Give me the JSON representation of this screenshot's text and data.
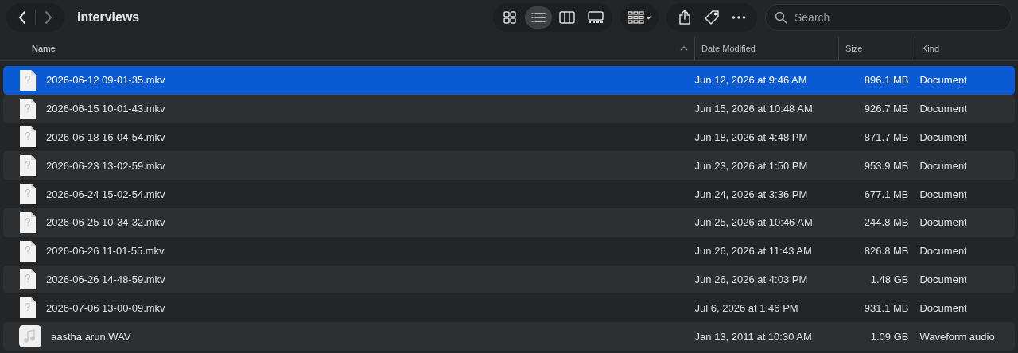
{
  "window": {
    "title": "interviews"
  },
  "views": [
    {
      "kind": "icons",
      "selected": false
    },
    {
      "kind": "list",
      "selected": true
    },
    {
      "kind": "columns",
      "selected": false
    },
    {
      "kind": "gallery",
      "selected": false
    }
  ],
  "search": {
    "placeholder": "Search"
  },
  "columns": [
    {
      "label": "Name",
      "sorted": true
    },
    {
      "label": "Date Modified",
      "sorted": false
    },
    {
      "label": "Size",
      "sorted": false
    },
    {
      "label": "Kind",
      "sorted": false
    }
  ],
  "rows": [
    {
      "kind": "document",
      "name": "2026-06-12 09-01-35.mkv",
      "date": "Jun 12, 2026 at 9:46 AM",
      "size": "896.1 MB",
      "type": "Document",
      "selected": true
    },
    {
      "kind": "document",
      "name": "2026-06-15 10-01-43.mkv",
      "date": "Jun 15, 2026 at 10:48 AM",
      "size": "926.7 MB",
      "type": "Document",
      "selected": false
    },
    {
      "kind": "document",
      "name": "2026-06-18 16-04-54.mkv",
      "date": "Jun 18, 2026 at 4:48 PM",
      "size": "871.7 MB",
      "type": "Document",
      "selected": false
    },
    {
      "kind": "document",
      "name": "2026-06-23 13-02-59.mkv",
      "date": "Jun 23, 2026 at 1:50 PM",
      "size": "953.9 MB",
      "type": "Document",
      "selected": false
    },
    {
      "kind": "document",
      "name": "2026-06-24 15-02-54.mkv",
      "date": "Jun 24, 2026 at 3:36 PM",
      "size": "677.1 MB",
      "type": "Document",
      "selected": false
    },
    {
      "kind": "document",
      "name": "2026-06-25 10-34-32.mkv",
      "date": "Jun 25, 2026 at 10:46 AM",
      "size": "244.8 MB",
      "type": "Document",
      "selected": false
    },
    {
      "kind": "document",
      "name": "2026-06-26 11-01-55.mkv",
      "date": "Jun 26, 2026 at 11:43 AM",
      "size": "826.8 MB",
      "type": "Document",
      "selected": false
    },
    {
      "kind": "document",
      "name": "2026-06-26 14-48-59.mkv",
      "date": "Jun 26, 2026 at 4:03 PM",
      "size": "1.48 GB",
      "type": "Document",
      "selected": false
    },
    {
      "kind": "document",
      "name": "2026-07-06 13-00-09.mkv",
      "date": "Jul 6, 2026 at 1:46 PM",
      "size": "931.1 MB",
      "type": "Document",
      "selected": false
    },
    {
      "kind": "audio",
      "name": "aastha arun.WAV",
      "date": "Jan 13, 2011 at 10:30 AM",
      "size": "1.09 GB",
      "type": "Waveform audio",
      "selected": false
    }
  ]
}
